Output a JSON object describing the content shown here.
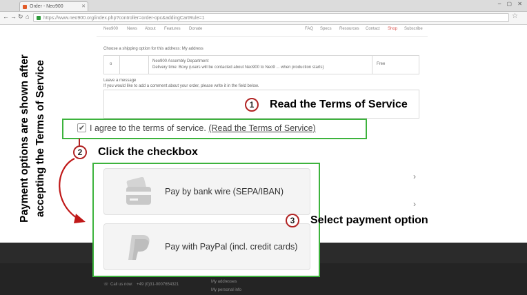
{
  "browser": {
    "tab_title": "Order - Neo900",
    "url": "https://www.neo900.org/index.php?controller=order-opc&addingCartRule=1"
  },
  "site_nav": {
    "left": [
      "Neo900",
      "News",
      "About",
      "Features",
      "Donate"
    ],
    "right": [
      "FAQ",
      "Specs",
      "Resources",
      "Contact",
      "Shop",
      "Subscribe"
    ],
    "active": "Shop"
  },
  "shipping": {
    "heading": "Choose a shipping option for this address: My address",
    "carrier_name": "Neo900 Assembly Department",
    "carrier_desc": "Delivery time: Boxy (users will be contacted about Neo900 to Neo9 ... when production starts)",
    "price": "Free",
    "radio": "o"
  },
  "message": {
    "label": "Leave a message",
    "hint": "If you would like to add a comment about your order, please write it in the field below."
  },
  "terms": {
    "agree_text": "I agree to the terms of service.",
    "link_text": "(Read the Terms of Service)",
    "checkbox_mark": "✔"
  },
  "callouts": {
    "step1": {
      "number": "1",
      "text": "Read the Terms of Service"
    },
    "step2": {
      "number": "2",
      "text": "Click the checkbox"
    },
    "step3": {
      "number": "3",
      "text": "Select payment option"
    }
  },
  "side_note": {
    "line1": "Payment options are shown after",
    "line2": "accepting the Terms of Service"
  },
  "payment_options": [
    {
      "label": "Pay by bank wire (SEPA/IBAN)",
      "icon": "bank-card-icon"
    },
    {
      "label": "Pay with PayPal (incl. credit cards)",
      "icon": "paypal-icon"
    }
  ],
  "footer": {
    "contact_label": "Call us now:",
    "contact_value": "+49 (0)31-0007654321",
    "links": [
      "My addresses",
      "My personal info"
    ]
  },
  "colors": {
    "highlight_green": "#3db33d",
    "callout_red": "#b12323",
    "arrow_red": "#c01818"
  }
}
